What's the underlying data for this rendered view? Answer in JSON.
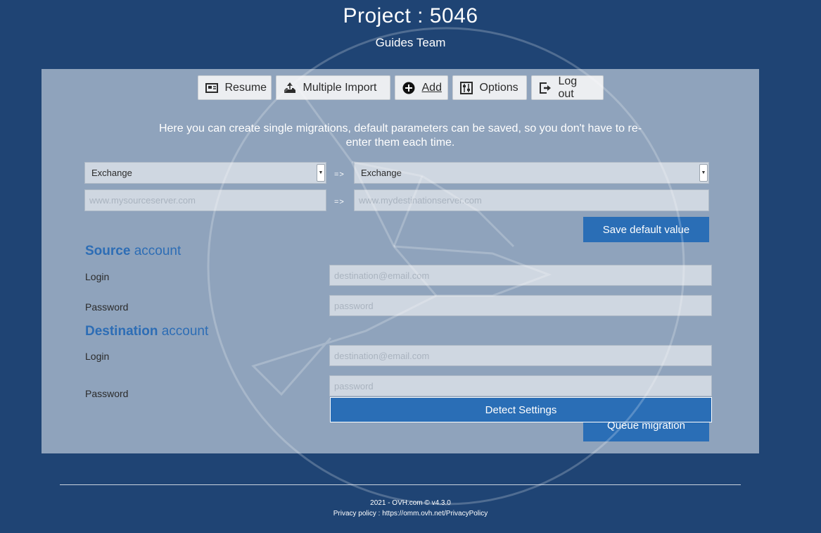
{
  "header": {
    "title": "Project :  5046",
    "subtitle": "Guides Team"
  },
  "nav": {
    "items": [
      {
        "label": "Resume",
        "icon": "resume-icon"
      },
      {
        "label": "Multiple Import",
        "icon": "import-icon"
      },
      {
        "label": "Add",
        "icon": "plus-circle-icon",
        "active": true
      },
      {
        "label": "Options",
        "icon": "sliders-icon"
      },
      {
        "label": "Log out",
        "icon": "logout-icon"
      }
    ]
  },
  "intro": "Here you can create single migrations, default parameters can be saved, so you don't have to re-enter them each time.",
  "source_type": {
    "value": "Exchange"
  },
  "destination_type": {
    "value": "Exchange"
  },
  "separator": "=>",
  "source_server": {
    "placeholder": "www.mysourceserver.com"
  },
  "destination_server": {
    "placeholder": "www.mydestinationserver.com"
  },
  "save_default_label": "Save default value",
  "source_account": {
    "title_bold": "Source",
    "title_rest": " account",
    "login_label": "Login",
    "login_placeholder": "destination@email.com",
    "password_label": "Password",
    "password_placeholder": "password"
  },
  "destination_account": {
    "title_bold": "Destination",
    "title_rest": " account",
    "login_label": "Login",
    "login_placeholder": "destination@email.com",
    "password_label": "Password",
    "password_placeholder": "password"
  },
  "detect_settings_label": "Detect Settings",
  "queue_migration_label": "Queue migration",
  "footer": {
    "copyright": "2021 - OVH.com © v4.3.0",
    "privacy": "Privacy policy : https://omm.ovh.net/PrivacyPolicy"
  },
  "colors": {
    "background": "#1f4474",
    "panel": "#8fa3bc",
    "accent": "#2a6eb6"
  }
}
